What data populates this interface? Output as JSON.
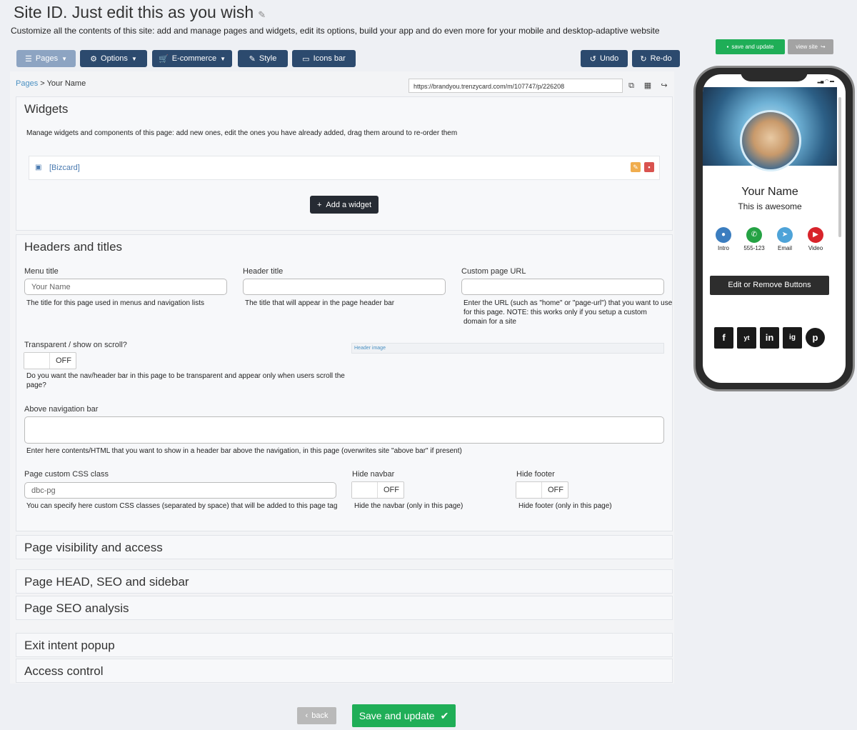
{
  "header": {
    "title": "Site ID. Just edit this as you wish",
    "description": "Customize all the contents of this site: add and manage pages and widgets, edit its options, build your app and do even more for your mobile and desktop-adaptive website"
  },
  "toolbar": {
    "pages": "Pages",
    "options": "Options",
    "ecommerce": "E-commerce",
    "style": "Style",
    "icons_bar": "Icons bar",
    "undo": "Undo",
    "redo": "Re-do"
  },
  "breadcrumb": {
    "root": "Pages",
    "separator": ">",
    "current": "Your Name"
  },
  "url": "https://brandyou.trenzycard.com/m/107747/p/226208",
  "widgets": {
    "title": "Widgets",
    "description": "Manage widgets and components of this page: add new ones, edit the ones you have already added, drag them around to re-order them",
    "items": [
      {
        "name": "[Bizcard]"
      }
    ],
    "add_label": "Add a widget"
  },
  "headers": {
    "title": "Headers and titles",
    "menu_title_label": "Menu title",
    "menu_title_value": "Your  Name",
    "menu_title_help": "The title for this page used in menus and navigation lists",
    "header_title_label": "Header title",
    "header_title_help": "The title that will appear in the page header bar",
    "custom_url_label": "Custom page URL",
    "custom_url_help_1": "Enter the URL (such as \"home\" or \"page-url\") that you want to use",
    "custom_url_help_2": "for this page. NOTE: this works only if you setup a custom",
    "custom_url_help_3": "domain for a site",
    "transparent_label": "Transparent / show on scroll?",
    "transparent_state": "OFF",
    "transparent_help_1": "Do you want the nav/header bar in this page to be transparent and appear only when users scroll the",
    "transparent_help_2": "page?",
    "header_image_label": "Header image",
    "above_nav_label": "Above navigation bar",
    "above_nav_help": "Enter here contents/HTML that you want to show in a header bar above the navigation, in this page (overwrites site \"above bar\" if present)",
    "css_label": "Page custom CSS class",
    "css_value": "dbc-pg",
    "css_help": "You can specify here custom CSS classes (separated by space) that will be added to this page tag",
    "hide_navbar_label": "Hide navbar",
    "hide_navbar_state": "OFF",
    "hide_navbar_help": "Hide the navbar (only in this page)",
    "hide_footer_label": "Hide footer",
    "hide_footer_state": "OFF",
    "hide_footer_help": "Hide footer (only in this page)"
  },
  "sections": {
    "visibility": "Page visibility and access",
    "head_seo": "Page HEAD, SEO and sidebar",
    "seo_analysis": "Page SEO analysis",
    "exit_intent": "Exit intent popup",
    "access_control": "Access control"
  },
  "footer": {
    "back": "back",
    "save": "Save and update"
  },
  "preview": {
    "save_top": "save and update",
    "view_site": "view site",
    "name": "Your Name",
    "tagline": "This is awesome",
    "buttons": [
      "Intro",
      "555-123",
      "Email",
      "Video"
    ],
    "edit_buttons": "Edit or Remove Buttons",
    "social": [
      "f",
      "yt",
      "in",
      "ig",
      "p"
    ]
  },
  "colors": {
    "primary": "#2c4a6e",
    "pages_button": "#8da4c2",
    "success": "#1fae57",
    "link": "#4a90c2",
    "edit_icon": "#f0ad4e",
    "delete_icon": "#d9534f"
  }
}
